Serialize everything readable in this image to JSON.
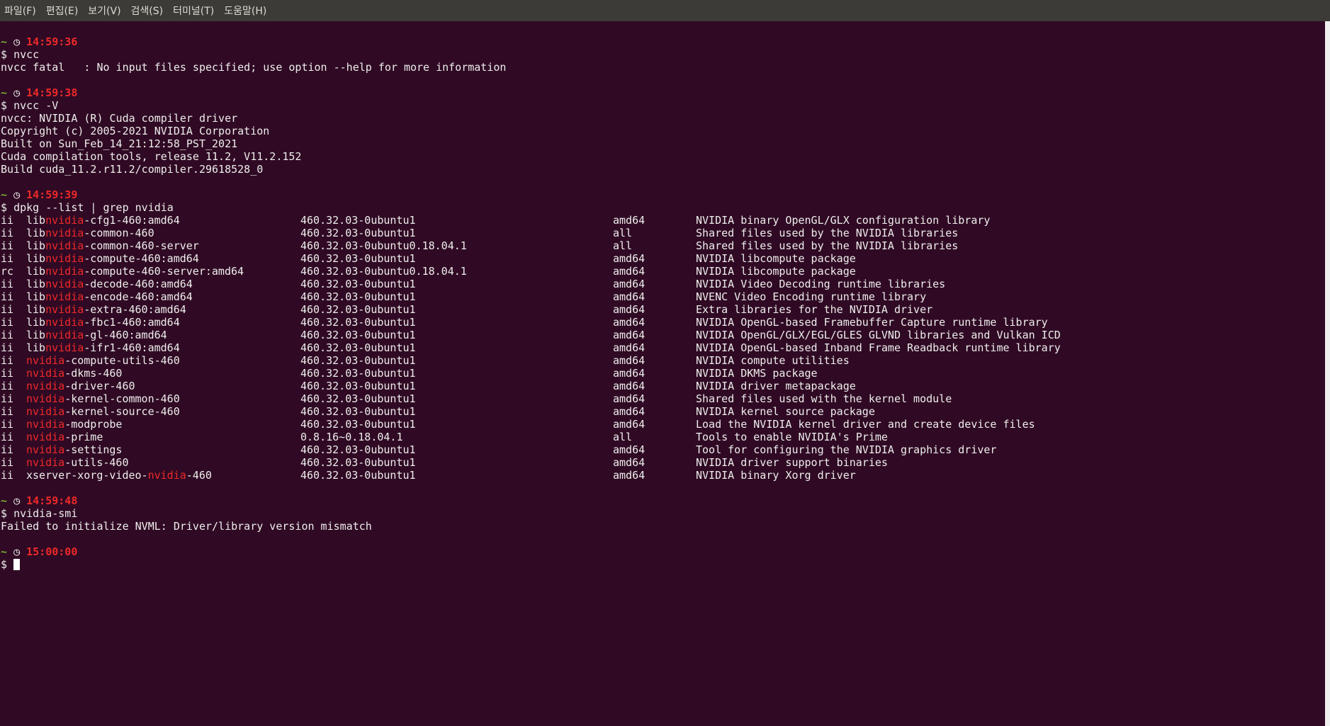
{
  "menu": [
    "파일(F)",
    "편집(E)",
    "보기(V)",
    "검색(S)",
    "터미널(T)",
    "도움말(H)"
  ],
  "prompt_symbol": "$",
  "tilde": "~",
  "blocks": [
    {
      "time": "14:59:36",
      "command": "nvcc",
      "output": [
        "nvcc fatal   : No input files specified; use option --help for more information"
      ]
    },
    {
      "time": "14:59:38",
      "command": "nvcc -V",
      "output": [
        "nvcc: NVIDIA (R) Cuda compiler driver",
        "Copyright (c) 2005-2021 NVIDIA Corporation",
        "Built on Sun_Feb_14_21:12:58_PST_2021",
        "Cuda compilation tools, release 11.2, V11.2.152",
        "Build cuda_11.2.r11.2/compiler.29618528_0"
      ]
    },
    {
      "time": "14:59:39",
      "command": "dpkg --list | grep nvidia",
      "highlight": "nvidia",
      "packages": [
        {
          "status": "ii",
          "name": "libnvidia-cfg1-460:amd64",
          "version": "460.32.03-0ubuntu1",
          "arch": "amd64",
          "desc": "NVIDIA binary OpenGL/GLX configuration library"
        },
        {
          "status": "ii",
          "name": "libnvidia-common-460",
          "version": "460.32.03-0ubuntu1",
          "arch": "all",
          "desc": "Shared files used by the NVIDIA libraries"
        },
        {
          "status": "ii",
          "name": "libnvidia-common-460-server",
          "version": "460.32.03-0ubuntu0.18.04.1",
          "arch": "all",
          "desc": "Shared files used by the NVIDIA libraries"
        },
        {
          "status": "ii",
          "name": "libnvidia-compute-460:amd64",
          "version": "460.32.03-0ubuntu1",
          "arch": "amd64",
          "desc": "NVIDIA libcompute package"
        },
        {
          "status": "rc",
          "name": "libnvidia-compute-460-server:amd64",
          "version": "460.32.03-0ubuntu0.18.04.1",
          "arch": "amd64",
          "desc": "NVIDIA libcompute package"
        },
        {
          "status": "ii",
          "name": "libnvidia-decode-460:amd64",
          "version": "460.32.03-0ubuntu1",
          "arch": "amd64",
          "desc": "NVIDIA Video Decoding runtime libraries"
        },
        {
          "status": "ii",
          "name": "libnvidia-encode-460:amd64",
          "version": "460.32.03-0ubuntu1",
          "arch": "amd64",
          "desc": "NVENC Video Encoding runtime library"
        },
        {
          "status": "ii",
          "name": "libnvidia-extra-460:amd64",
          "version": "460.32.03-0ubuntu1",
          "arch": "amd64",
          "desc": "Extra libraries for the NVIDIA driver"
        },
        {
          "status": "ii",
          "name": "libnvidia-fbc1-460:amd64",
          "version": "460.32.03-0ubuntu1",
          "arch": "amd64",
          "desc": "NVIDIA OpenGL-based Framebuffer Capture runtime library"
        },
        {
          "status": "ii",
          "name": "libnvidia-gl-460:amd64",
          "version": "460.32.03-0ubuntu1",
          "arch": "amd64",
          "desc": "NVIDIA OpenGL/GLX/EGL/GLES GLVND libraries and Vulkan ICD"
        },
        {
          "status": "ii",
          "name": "libnvidia-ifr1-460:amd64",
          "version": "460.32.03-0ubuntu1",
          "arch": "amd64",
          "desc": "NVIDIA OpenGL-based Inband Frame Readback runtime library"
        },
        {
          "status": "ii",
          "name": "nvidia-compute-utils-460",
          "version": "460.32.03-0ubuntu1",
          "arch": "amd64",
          "desc": "NVIDIA compute utilities"
        },
        {
          "status": "ii",
          "name": "nvidia-dkms-460",
          "version": "460.32.03-0ubuntu1",
          "arch": "amd64",
          "desc": "NVIDIA DKMS package"
        },
        {
          "status": "ii",
          "name": "nvidia-driver-460",
          "version": "460.32.03-0ubuntu1",
          "arch": "amd64",
          "desc": "NVIDIA driver metapackage"
        },
        {
          "status": "ii",
          "name": "nvidia-kernel-common-460",
          "version": "460.32.03-0ubuntu1",
          "arch": "amd64",
          "desc": "Shared files used with the kernel module"
        },
        {
          "status": "ii",
          "name": "nvidia-kernel-source-460",
          "version": "460.32.03-0ubuntu1",
          "arch": "amd64",
          "desc": "NVIDIA kernel source package"
        },
        {
          "status": "ii",
          "name": "nvidia-modprobe",
          "version": "460.32.03-0ubuntu1",
          "arch": "amd64",
          "desc": "Load the NVIDIA kernel driver and create device files"
        },
        {
          "status": "ii",
          "name": "nvidia-prime",
          "version": "0.8.16~0.18.04.1",
          "arch": "all",
          "desc": "Tools to enable NVIDIA's Prime"
        },
        {
          "status": "ii",
          "name": "nvidia-settings",
          "version": "460.32.03-0ubuntu1",
          "arch": "amd64",
          "desc": "Tool for configuring the NVIDIA graphics driver"
        },
        {
          "status": "ii",
          "name": "nvidia-utils-460",
          "version": "460.32.03-0ubuntu1",
          "arch": "amd64",
          "desc": "NVIDIA driver support binaries"
        },
        {
          "status": "ii",
          "name": "xserver-xorg-video-nvidia-460",
          "version": "460.32.03-0ubuntu1",
          "arch": "amd64",
          "desc": "NVIDIA binary Xorg driver"
        }
      ]
    },
    {
      "time": "14:59:48",
      "command": "nvidia-smi",
      "output": [
        "Failed to initialize NVML: Driver/library version mismatch"
      ]
    },
    {
      "time": "15:00:00",
      "command": "",
      "active": true
    }
  ],
  "colors": {
    "background": "#300a24",
    "text": "#eeeeec",
    "accent": "#ef2929",
    "tilde": "#8ae234",
    "menubar": "#3c3b37"
  }
}
